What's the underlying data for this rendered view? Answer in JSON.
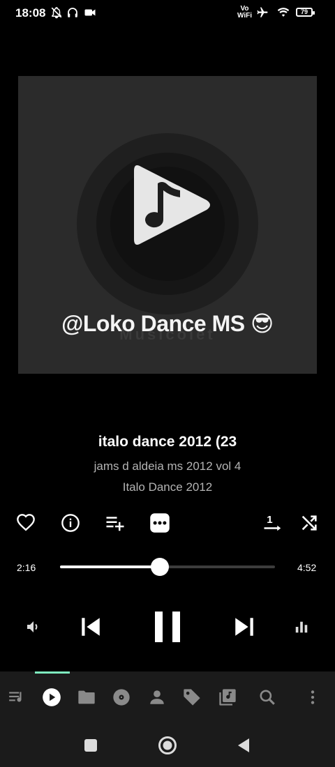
{
  "status_bar": {
    "time": "18:08",
    "vowifi_top": "Vo",
    "vowifi_bottom": "WiFi",
    "battery": "79",
    "icons": [
      "bell-off-icon",
      "headphones-icon",
      "video-icon",
      "airplane-icon",
      "wifi-icon",
      "battery-icon"
    ]
  },
  "artwork": {
    "handle": "@Loko Dance MS 😎",
    "brand": "Musicolet",
    "icon": "music-play-icon"
  },
  "song": {
    "title": "italo dance 2012 (23",
    "album": "jams d aldeia ms 2012 vol 4",
    "genre": "Italo Dance 2012"
  },
  "actions": [
    "heart-icon",
    "info-icon",
    "add-to-queue-icon",
    "more-icon",
    "repeat-one-icon",
    "shuffle-icon"
  ],
  "player": {
    "elapsed": "2:16",
    "duration": "4:52",
    "progress": 0.4658
  },
  "transport": [
    "volume-icon",
    "previous-icon",
    "pause-icon",
    "next-icon",
    "equalizer-icon"
  ],
  "bottom_nav": [
    "queue-icon",
    "now-playing-icon",
    "folders-icon",
    "albums-icon",
    "artists-icon",
    "tags-icon",
    "playlists-icon",
    "search-icon",
    "overflow-menu-icon"
  ],
  "system_nav": [
    "recents-icon",
    "home-icon",
    "back-icon"
  ],
  "colors": {
    "accent": "#7ff0c0",
    "background": "#000000",
    "artwork_bg": "#2b2b2b",
    "navbar_bg": "#1b1b1b"
  }
}
